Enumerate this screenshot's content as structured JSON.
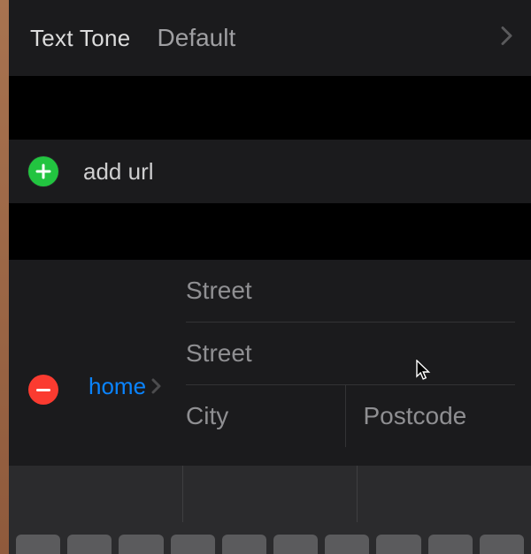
{
  "tone": {
    "label": "Text Tone",
    "value": "Default"
  },
  "url": {
    "add_label": "add url"
  },
  "address": {
    "type_label": "home",
    "street1_placeholder": "Street",
    "street2_placeholder": "Street",
    "city_placeholder": "City",
    "postcode_placeholder": "Postcode"
  }
}
